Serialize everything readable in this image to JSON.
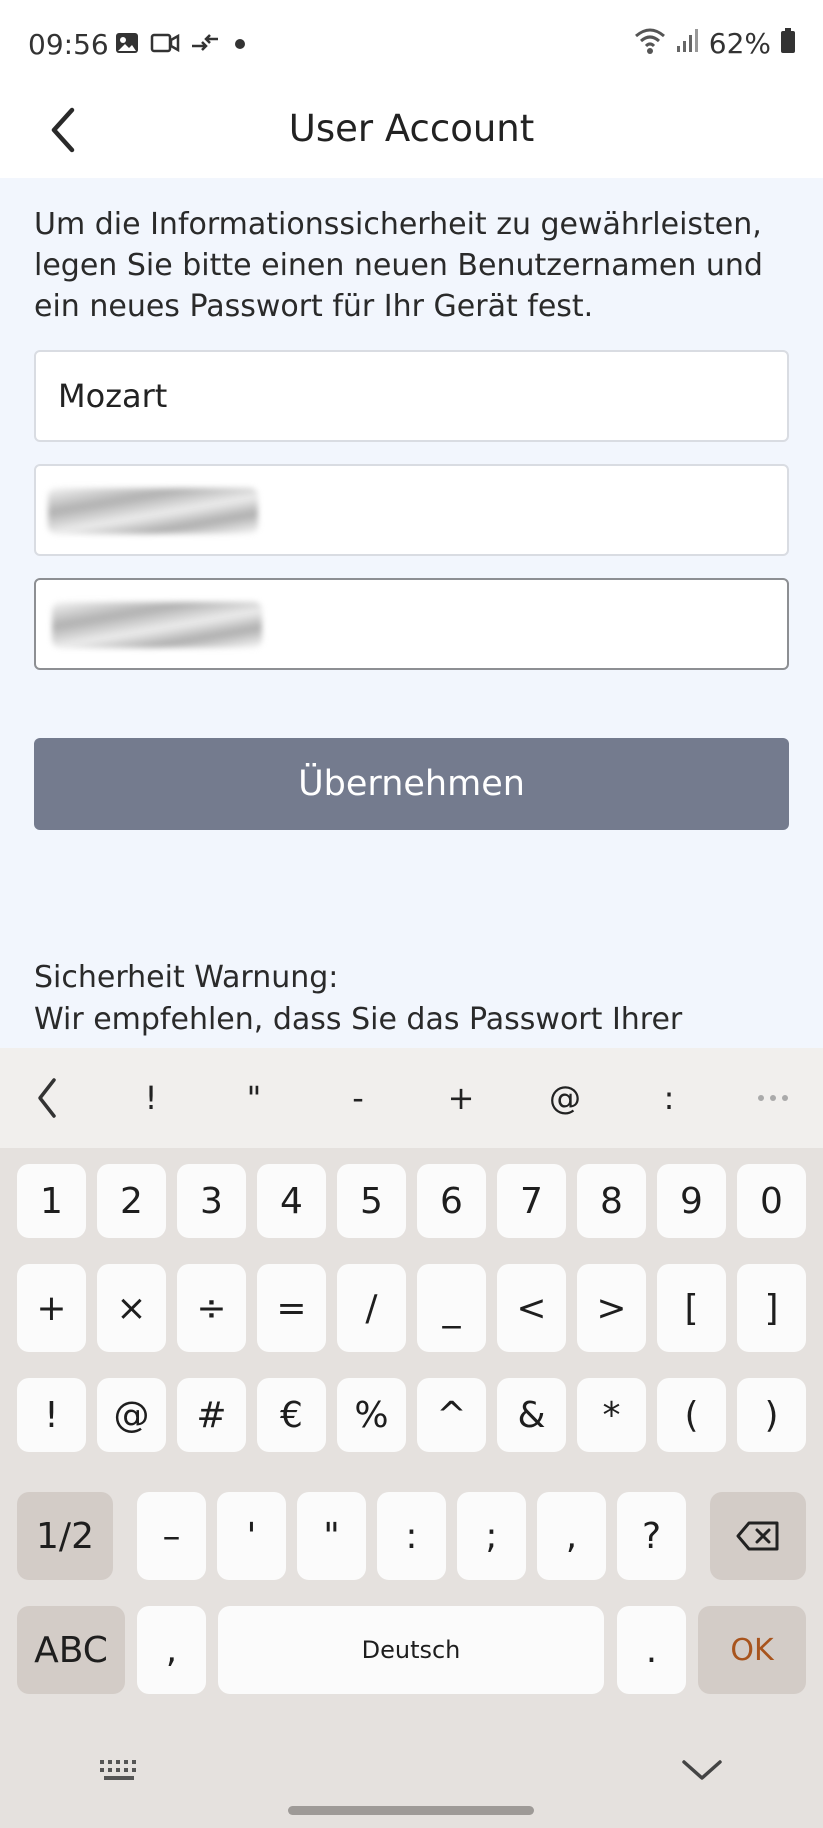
{
  "status_bar": {
    "time": "09:56",
    "left_icons": [
      "gallery-icon",
      "video-call-icon",
      "data-transfer-icon",
      "dot-icon"
    ],
    "right_icons": [
      "wifi-icon",
      "signal-icon",
      "battery-icon"
    ],
    "battery": "62%"
  },
  "app_bar": {
    "title": "User Account"
  },
  "form": {
    "info": "Um die Informationssicherheit zu gewährleisten, legen Sie bitte einen neuen Benutzernamen und ein neues Passwort für Ihr Gerät fest.",
    "username_value": "Mozart",
    "submit_label": "Übernehmen",
    "warning_title": "Sicherheit Warnung:",
    "warning_text": "Wir empfehlen, dass Sie das Passwort Ihrer"
  },
  "keyboard": {
    "toolbar": [
      "!",
      "\"",
      "-",
      "+",
      "@",
      ":"
    ],
    "row1": [
      "1",
      "2",
      "3",
      "4",
      "5",
      "6",
      "7",
      "8",
      "9",
      "0"
    ],
    "row2": [
      "+",
      "×",
      "÷",
      "=",
      "/",
      "_",
      "<",
      ">",
      "[",
      "]"
    ],
    "row3": [
      "!",
      "@",
      "#",
      "€",
      "%",
      "^",
      "&",
      "*",
      "(",
      ")"
    ],
    "row4_page": "1/2",
    "row4": [
      "–",
      "'",
      "\"",
      ":",
      ";",
      ",",
      "?"
    ],
    "abc": "ABC",
    "comma": ",",
    "space": "Deutsch",
    "period": ".",
    "ok": "OK",
    "accent_color": "#a8541d"
  }
}
